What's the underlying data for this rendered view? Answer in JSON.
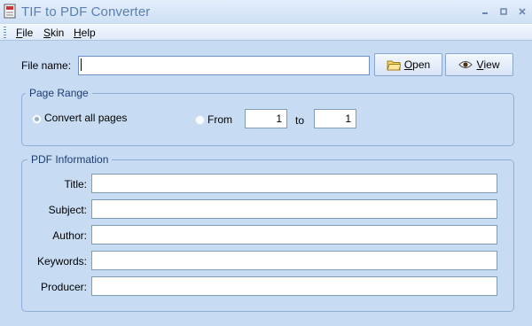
{
  "window": {
    "title": "TIF to PDF Converter",
    "minimize_glyph": "minimize-icon",
    "maximize_glyph": "maximize-icon",
    "close_glyph": "close-icon"
  },
  "menu": {
    "items": [
      {
        "label": "File",
        "mnemonic": "F",
        "rest": "ile"
      },
      {
        "label": "Skin",
        "mnemonic": "S",
        "rest": "kin"
      },
      {
        "label": "Help",
        "mnemonic": "H",
        "rest": "elp"
      }
    ]
  },
  "file_row": {
    "label": "File name:",
    "value": "",
    "open_button": {
      "mnemonic": "O",
      "rest": "pen",
      "icon": "folder-icon"
    },
    "view_button": {
      "mnemonic": "V",
      "rest": "iew",
      "icon": "eye-icon"
    }
  },
  "page_range": {
    "title": "Page Range",
    "convert_all_label": "Convert all pages",
    "from_label": "From",
    "to_label": "to",
    "from_value": "1",
    "to_value": "1",
    "selected": "convert_all"
  },
  "pdf_info": {
    "title": "PDF Information",
    "fields": [
      {
        "label": "Title:",
        "value": ""
      },
      {
        "label": "Subject:",
        "value": ""
      },
      {
        "label": "Author:",
        "value": ""
      },
      {
        "label": "Keywords:",
        "value": ""
      },
      {
        "label": "Producer:",
        "value": ""
      }
    ]
  },
  "colors": {
    "background": "#c7dbf2",
    "title_text": "#5a7fb0",
    "group_border": "#8fafda",
    "group_title": "#1b3d73"
  }
}
